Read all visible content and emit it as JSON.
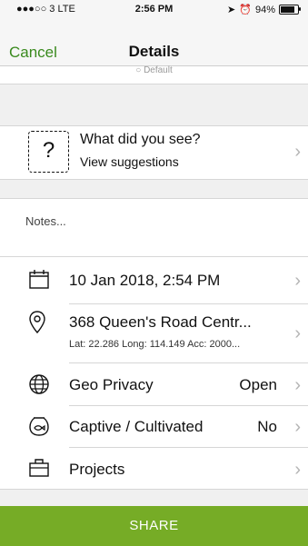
{
  "status_bar": {
    "carrier": "●●●○○ 3  LTE",
    "time": "2:56 PM",
    "battery": "94%",
    "battery_level": 0.94
  },
  "nav": {
    "cancel": "Cancel",
    "title": "Details",
    "behind_text": "Default"
  },
  "what": {
    "title": "What did you see?",
    "subtitle": "View suggestions"
  },
  "notes": {
    "placeholder": "Notes..."
  },
  "date_row": {
    "label": "10 Jan 2018, 2:54 PM"
  },
  "location_row": {
    "label": "368 Queen's Road Centr...",
    "coords": "Lat: 22.286  Long: 114.149  Acc: 2000..."
  },
  "geo_privacy_row": {
    "label": "Geo Privacy",
    "value": "Open"
  },
  "captive_row": {
    "label": "Captive / Cultivated",
    "value": "No"
  },
  "projects_row": {
    "label": "Projects"
  },
  "share": {
    "label": "SHARE"
  },
  "colors": {
    "accent": "#3a8a1e",
    "share_bg": "#76ac26"
  }
}
